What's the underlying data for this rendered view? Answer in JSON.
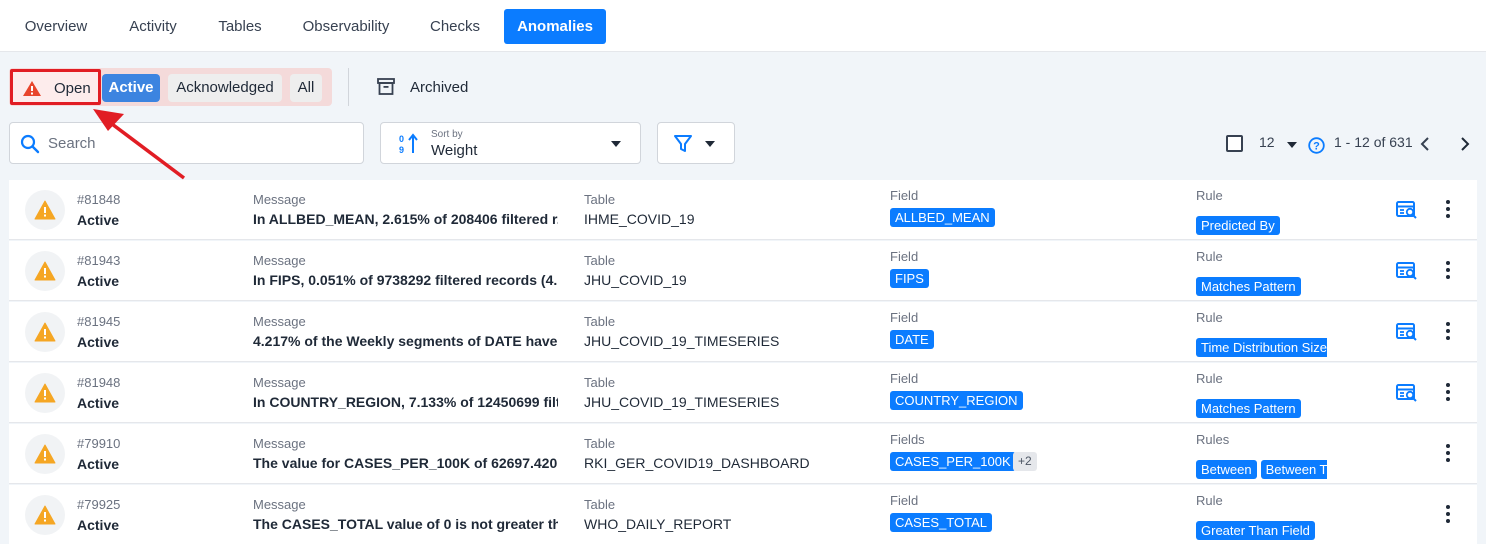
{
  "tabs": [
    {
      "label": "Overview",
      "active": false
    },
    {
      "label": "Activity",
      "active": false
    },
    {
      "label": "Tables",
      "active": false
    },
    {
      "label": "Observability",
      "active": false
    },
    {
      "label": "Checks",
      "active": false
    },
    {
      "label": "Anomalies",
      "active": true
    }
  ],
  "status_filter": {
    "open_label": "Open",
    "active_label": "Active",
    "acknowledged_label": "Acknowledged",
    "all_label": "All",
    "archived_label": "Archived"
  },
  "search": {
    "placeholder": "Search"
  },
  "sort": {
    "caption": "Sort by",
    "value": "Weight"
  },
  "pagination": {
    "page_size": "12",
    "range": "1 - 12 of 631"
  },
  "rows": [
    {
      "id": "#81848",
      "status": "Active",
      "message_label": "Message",
      "message": "In ALLBED_MEAN, 2.615% of 208406 filtered r...",
      "table_label": "Table",
      "table": "IHME_COVID_19",
      "field_label": "Field",
      "fields": [
        "ALLBED_MEAN"
      ],
      "field_more": "",
      "rule_label": "Rule",
      "rules": [
        "Predicted By"
      ],
      "has_source_icon": true
    },
    {
      "id": "#81943",
      "status": "Active",
      "message_label": "Message",
      "message": "In FIPS, 0.051% of 9738292 filtered records (4...",
      "table_label": "Table",
      "table": "JHU_COVID_19",
      "field_label": "Field",
      "fields": [
        "FIPS"
      ],
      "field_more": "",
      "rule_label": "Rule",
      "rules": [
        "Matches Pattern"
      ],
      "has_source_icon": true
    },
    {
      "id": "#81945",
      "status": "Active",
      "message_label": "Message",
      "message": "4.217% of the Weekly segments of DATE have ...",
      "table_label": "Table",
      "table": "JHU_COVID_19_TIMESERIES",
      "field_label": "Field",
      "fields": [
        "DATE"
      ],
      "field_more": "",
      "rule_label": "Rule",
      "rules": [
        "Time Distribution Size"
      ],
      "has_source_icon": true
    },
    {
      "id": "#81948",
      "status": "Active",
      "message_label": "Message",
      "message": "In COUNTRY_REGION, 7.133% of 12450699 filt...",
      "table_label": "Table",
      "table": "JHU_COVID_19_TIMESERIES",
      "field_label": "Field",
      "fields": [
        "COUNTRY_REGION"
      ],
      "field_more": "",
      "rule_label": "Rule",
      "rules": [
        "Matches Pattern"
      ],
      "has_source_icon": true
    },
    {
      "id": "#79910",
      "status": "Active",
      "message_label": "Message",
      "message": "The value for CASES_PER_100K of 62697.420...",
      "table_label": "Table",
      "table": "RKI_GER_COVID19_DASHBOARD",
      "field_label": "Fields",
      "fields": [
        "CASES_PER_100K"
      ],
      "field_more": "+2",
      "rule_label": "Rules",
      "rules": [
        "Between",
        "Between Time"
      ],
      "has_source_icon": false
    },
    {
      "id": "#79925",
      "status": "Active",
      "message_label": "Message",
      "message": "The CASES_TOTAL value of 0 is not greater th...",
      "table_label": "Table",
      "table": "WHO_DAILY_REPORT",
      "field_label": "Field",
      "fields": [
        "CASES_TOTAL"
      ],
      "field_more": "",
      "rule_label": "Rule",
      "rules": [
        "Greater Than Field"
      ],
      "has_source_icon": false
    }
  ],
  "colors": {
    "accent": "#0b7cff",
    "warning": "#f5a623",
    "highlight": "#e11d24"
  }
}
